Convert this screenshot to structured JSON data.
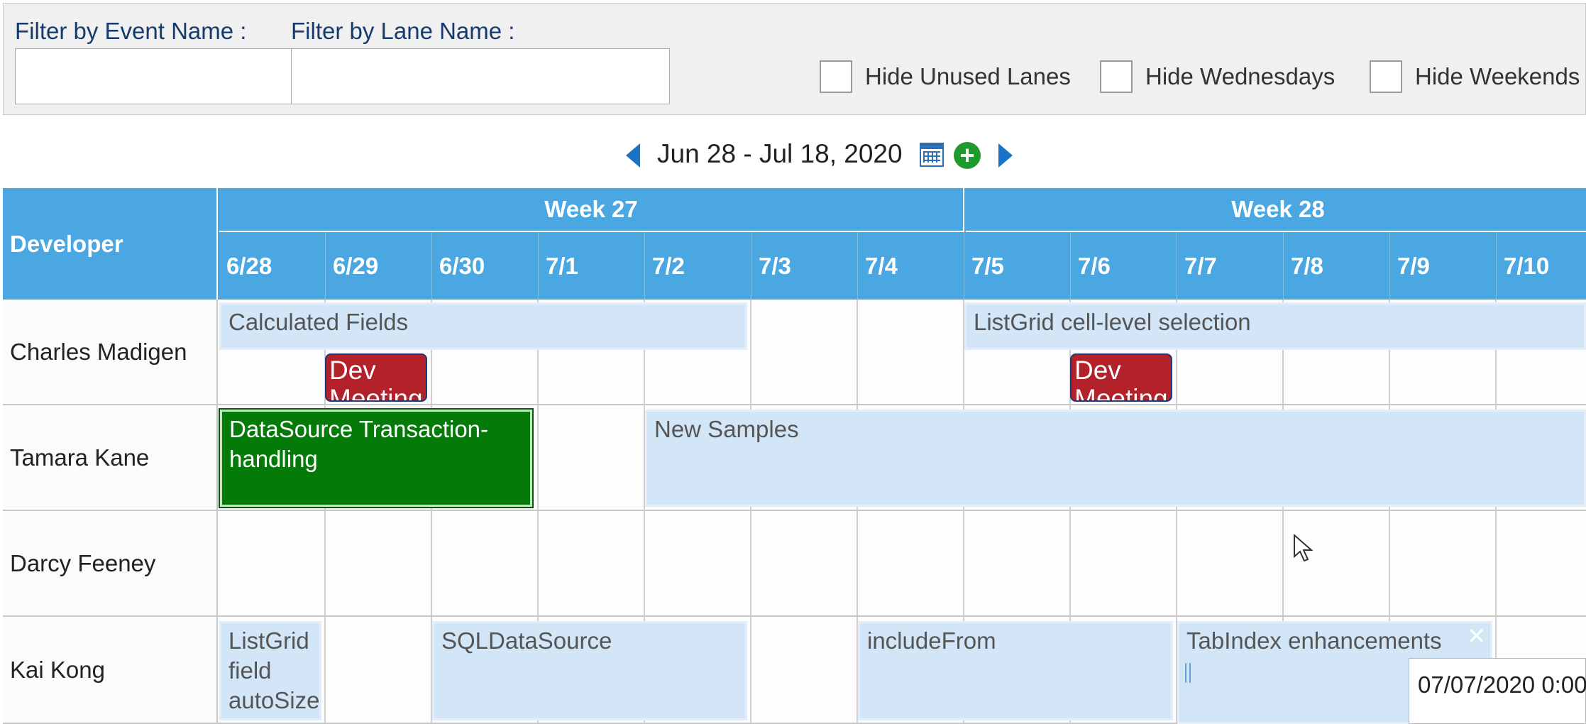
{
  "filters": {
    "event_name_label": "Filter by Event Name :",
    "event_name_value": "",
    "lane_name_label": "Filter by Lane Name :",
    "lane_name_value": "",
    "checkboxes": [
      {
        "label": "Hide Unused Lanes",
        "checked": false
      },
      {
        "label": "Hide Wednesdays",
        "checked": false
      },
      {
        "label": "Hide Weekends",
        "checked": false
      }
    ]
  },
  "navigator": {
    "date_range": "Jun 28 - Jul 18, 2020",
    "prev_icon": "chevron-left-icon",
    "next_icon": "chevron-right-icon",
    "calendar_icon": "calendar-icon",
    "add_icon": "add-event-icon"
  },
  "grid": {
    "lane_header": "Developer",
    "weeks": [
      "Week 27",
      "Week 28"
    ],
    "days": [
      "6/28",
      "6/29",
      "6/30",
      "7/1",
      "7/2",
      "7/3",
      "7/4",
      "7/5",
      "7/6",
      "7/7",
      "7/8",
      "7/9",
      "7/10"
    ],
    "lanes": [
      "Charles Madigen",
      "Tamara Kane",
      "Darcy Feeney",
      "Kai Kong"
    ]
  },
  "events": {
    "calculated_fields": "Calculated Fields",
    "listgrid_cell_selection": "ListGrid cell-level selection",
    "dev_meeting_1": "Dev Meeting",
    "dev_meeting_2": "Dev Meeting",
    "datasource_transaction": "DataSource Transaction-handling",
    "new_samples": "New Samples",
    "listgrid_field_autosize": "ListGrid field autoSize",
    "sqldatasource": "SQLDataSource",
    "includefrom": "includeFrom",
    "tabindex_enhancements": "TabIndex enhancements"
  },
  "tooltip": "07/07/2020 0:00",
  "colors": {
    "header_blue": "#4aa7e2",
    "event_light": "#d2e6f7",
    "event_red": "#b3212a",
    "event_green": "#047a08",
    "nav_blue": "#1a73c5",
    "add_green": "#1f9b2e"
  }
}
